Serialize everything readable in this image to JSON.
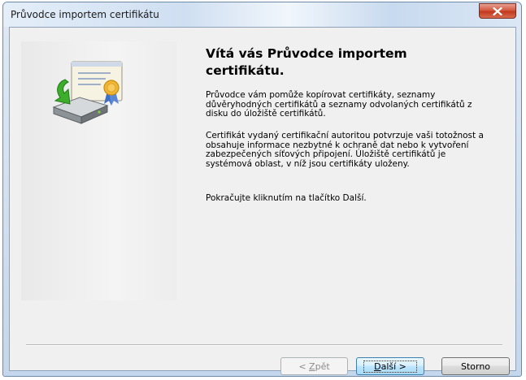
{
  "window": {
    "title": "Průvodce importem certifikátu"
  },
  "main": {
    "heading": "Vítá vás Průvodce importem certifikátu.",
    "paragraph1": "Průvodce vám pomůže kopírovat certifikáty, seznamy důvěryhodných certifikátů a seznamy odvolaných certifikátů z disku do úložiště certifikátů.",
    "paragraph2": "Certifikát vydaný certifikační autoritou potvrzuje vaši totožnost a obsahuje informace nezbytné k ochraně dat nebo k vytvoření zabezpečených síťových připojení. Úložiště certifikátů je systémová oblast, v níž jsou certifikáty uloženy.",
    "paragraph3": "Pokračujte kliknutím na tlačítko Další."
  },
  "buttons": {
    "back": {
      "prefix": "< ",
      "mnemonic": "Z",
      "rest": "pět",
      "enabled": false
    },
    "next": {
      "mnemonic": "D",
      "rest": "alší >",
      "default": true
    },
    "cancel": "Storno"
  },
  "icons": {
    "wizard": "certificate-import-icon",
    "close": "close-icon"
  },
  "colors": {
    "close_button": "#c2381e",
    "default_button_border": "#3c7fb1"
  }
}
